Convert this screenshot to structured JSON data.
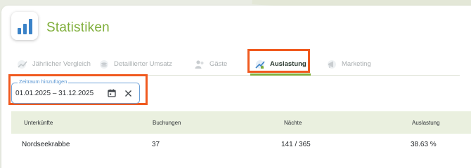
{
  "app": {
    "title": "Statistiken"
  },
  "tabs": [
    {
      "label": "Jährlicher Vergleich",
      "icon": "trend-chart-icon",
      "active": false
    },
    {
      "label": "Detaillierter Umsatz",
      "icon": "coins-icon",
      "active": false
    },
    {
      "label": "Gäste",
      "icon": "guests-icon",
      "active": false
    },
    {
      "label": "Auslastung",
      "icon": "occupancy-house-icon",
      "active": true
    },
    {
      "label": "Marketing",
      "icon": "megaphone-icon",
      "active": false
    }
  ],
  "date_filter": {
    "label": "Zeitraum hinzufügen",
    "value": "01.01.2025 – 31.12.2025"
  },
  "table": {
    "columns": [
      "Unterkünfte",
      "Buchungen",
      "Nächte",
      "Auslastung"
    ],
    "rows": [
      [
        "Nordseekrabbe",
        "37",
        "141 / 365",
        "38.63 %"
      ]
    ]
  },
  "colors": {
    "accent": "#7fae3a",
    "highlight": "#f05a1f",
    "field_border": "#6da1d8"
  }
}
